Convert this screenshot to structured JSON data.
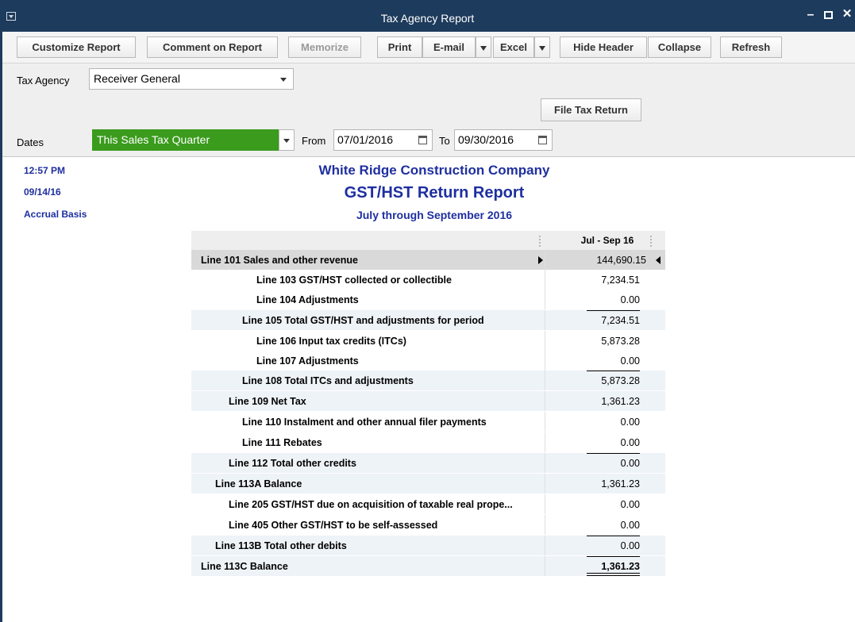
{
  "window": {
    "title": "Tax Agency Report",
    "minimize_icon": "minimize-icon",
    "maximize_icon": "maximize-icon",
    "close_icon": "close-icon"
  },
  "toolbar": {
    "customize": "Customize Report",
    "comment": "Comment on Report",
    "memorize": "Memorize",
    "print": "Print",
    "email": "E-mail",
    "excel": "Excel",
    "hide_header": "Hide Header",
    "collapse": "Collapse",
    "refresh": "Refresh"
  },
  "filters": {
    "tax_agency_label": "Tax Agency",
    "tax_agency_value": "Receiver General",
    "file_tax_return": "File Tax Return",
    "dates_label": "Dates",
    "dates_value": "This Sales Tax Quarter",
    "from_label": "From",
    "from_value": "07/01/2016",
    "to_label": "To",
    "to_value": "09/30/2016"
  },
  "report": {
    "time": "12:57 PM",
    "date": "09/14/16",
    "basis": "Accrual Basis",
    "company": "White Ridge Construction Company",
    "title": "GST/HST Return Report",
    "period": "July through September 2016",
    "column_header": "Jul - Sep 16",
    "rows": [
      {
        "name": "Line 101 Sales and other revenue",
        "value": "144,690.15"
      },
      {
        "name": "Line 103 GST/HST collected or collectible",
        "value": "7,234.51"
      },
      {
        "name": "Line 104 Adjustments",
        "value": "0.00"
      },
      {
        "name": "Line 105 Total GST/HST and adjustments for period",
        "value": "7,234.51"
      },
      {
        "name": "Line 106 Input tax credits (ITCs)",
        "value": "5,873.28"
      },
      {
        "name": "Line 107 Adjustments",
        "value": "0.00"
      },
      {
        "name": "Line 108 Total ITCs and adjustments",
        "value": "5,873.28"
      },
      {
        "name": "Line 109 Net Tax",
        "value": "1,361.23"
      },
      {
        "name": "Line 110 Instalment and other annual filer payments",
        "value": "0.00"
      },
      {
        "name": "Line 111 Rebates",
        "value": "0.00"
      },
      {
        "name": "Line 112 Total other credits",
        "value": "0.00"
      },
      {
        "name": "Line 113A Balance",
        "value": "1,361.23"
      },
      {
        "name": "Line 205 GST/HST due on acquisition of taxable real prope...",
        "value": "0.00"
      },
      {
        "name": "Line 405 Other GST/HST to be self-assessed",
        "value": "0.00"
      },
      {
        "name": "Line 113B Total other debits",
        "value": "0.00"
      },
      {
        "name": "Line 113C Balance",
        "value": "1,361.23"
      }
    ]
  }
}
